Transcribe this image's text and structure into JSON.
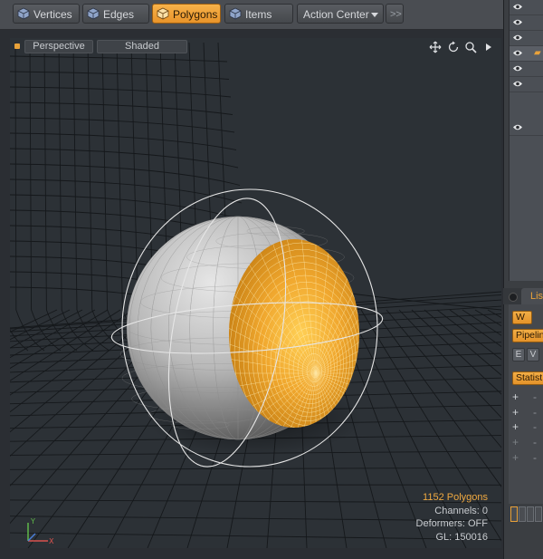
{
  "toolbar": {
    "buttons": [
      {
        "label": "Vertices",
        "icon": "vertices-cube-icon",
        "active": false
      },
      {
        "label": "Edges",
        "icon": "edges-cube-icon",
        "active": false
      },
      {
        "label": "Polygons",
        "icon": "polygons-cube-icon",
        "active": true
      },
      {
        "label": "Items",
        "icon": "items-cube-icon",
        "active": false
      }
    ],
    "action_center": "Action Center",
    "more": ">>"
  },
  "viewport": {
    "projection": "Perspective",
    "shading": "Shaded",
    "controls": [
      "move-icon",
      "rotate-icon",
      "zoom-icon",
      "play-icon"
    ],
    "stats": {
      "polygons": "1152 Polygons",
      "channels": "Channels: 0",
      "deformers": "Deformers: OFF",
      "gl": "GL: 150016"
    },
    "axis_labels": {
      "x": "X",
      "y": "Y"
    }
  },
  "item_list": {
    "rows": [
      "eye-icon",
      "eye-icon",
      "eye-icon",
      "eye-icon",
      "eye-icon",
      "eye-icon",
      "eye-icon"
    ]
  },
  "panel_tabs": {
    "active_tab": "Lis"
  },
  "properties": {
    "w_button": "W",
    "pipeline_button": "Pipelin",
    "e_button": "E",
    "v_button": "V",
    "statistics_button": "Statist",
    "plus_rows": [
      {
        "plus": "+",
        "minus": "-"
      },
      {
        "plus": "+",
        "minus": "-"
      },
      {
        "plus": "+",
        "minus": "-"
      },
      {
        "plus": "+",
        "minus": "-"
      },
      {
        "plus": "+",
        "minus": "-"
      }
    ]
  },
  "colors": {
    "accent": "#f0a940",
    "selection": "#f5a623",
    "background": "#2c3136"
  }
}
